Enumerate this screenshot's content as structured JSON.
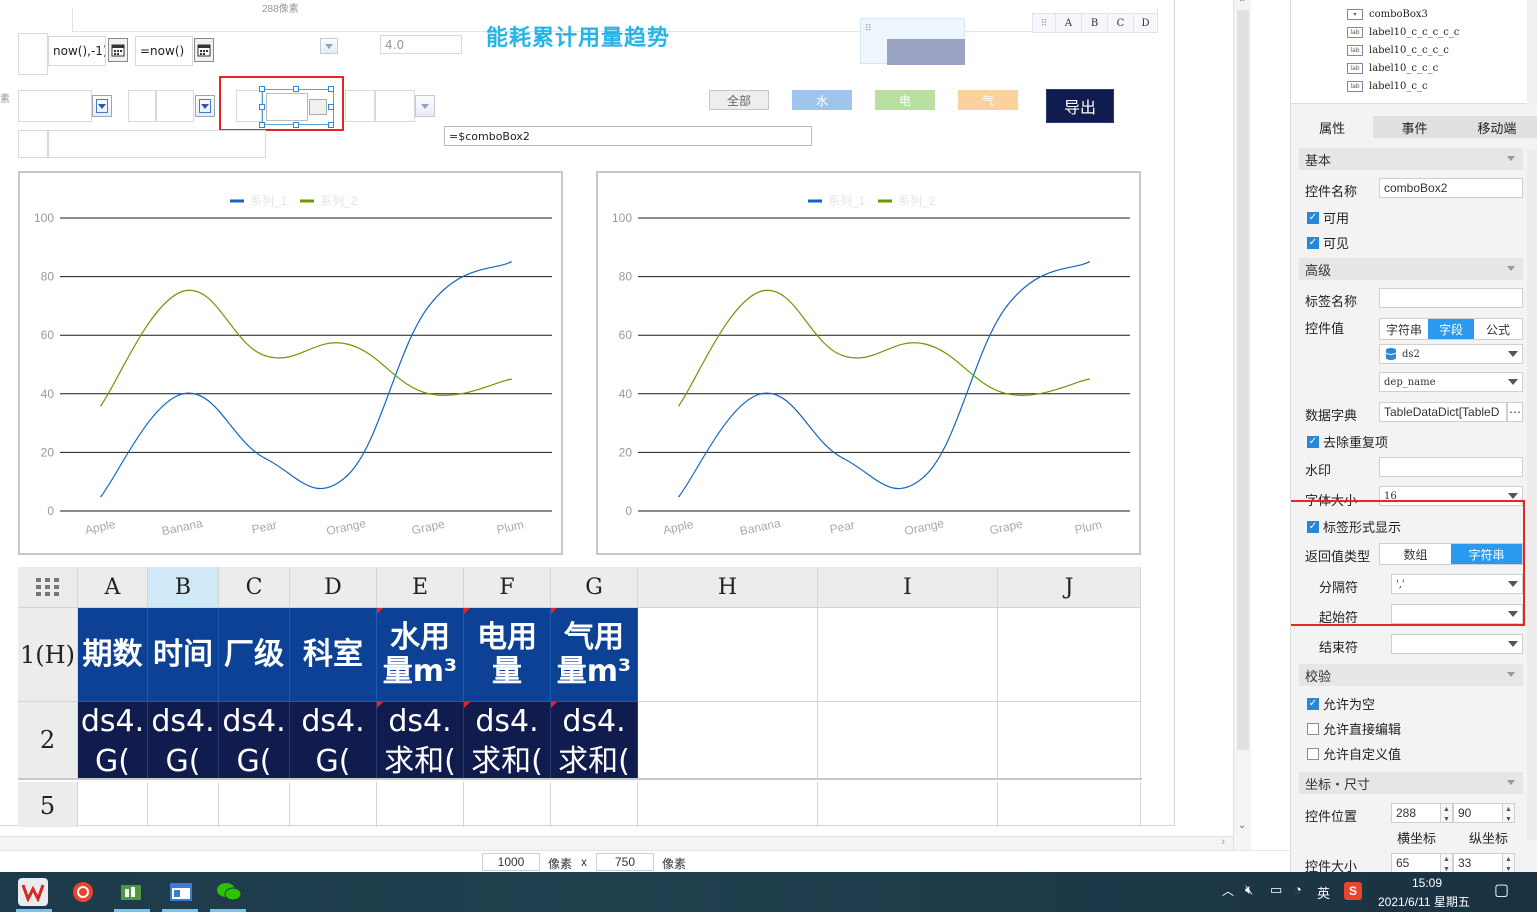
{
  "canvas": {
    "ruler_tip": "288像素",
    "ruler_side": "素",
    "title": "能耗累计用量趋势",
    "start_date_formula": "now(),-1)",
    "end_date_formula": "=now()",
    "version_field": "4.0",
    "combo_formula": "=$comboBox2",
    "filter_buttons": [
      {
        "label": "全部",
        "color": "#eeeeee",
        "text_color": "#666666"
      },
      {
        "label": "水",
        "color": "#9fc5ec",
        "text_color": "#ffffff"
      },
      {
        "label": "电",
        "color": "#b9dfa1",
        "text_color": "#ffffff"
      },
      {
        "label": "气",
        "color": "#fbd1a0",
        "text_color": "#ffffff"
      }
    ],
    "export_label": "导出",
    "mini_grid_cols": [
      "A",
      "B",
      "C",
      "D"
    ]
  },
  "chart_data": [
    {
      "type": "line",
      "categories": [
        "Apple",
        "Banana",
        "Pear",
        "Orange",
        "Grape",
        "Plum"
      ],
      "series": [
        {
          "name": "系列_1",
          "color": "#1565c0",
          "values": [
            5,
            40,
            18,
            12,
            70,
            85
          ]
        },
        {
          "name": "系列_2",
          "color": "#6a9a00",
          "values": [
            36,
            75,
            53,
            57,
            40,
            45
          ]
        }
      ],
      "yticks": [
        0,
        20,
        40,
        60,
        80,
        100
      ],
      "ylim": [
        0,
        100
      ],
      "smooth": true,
      "grid": true,
      "legend": "top-center"
    },
    {
      "type": "line",
      "categories": [
        "Apple",
        "Banana",
        "Pear",
        "Orange",
        "Grape",
        "Plum"
      ],
      "series": [
        {
          "name": "系列_1",
          "color": "#1565c0",
          "values": [
            5,
            40,
            18,
            12,
            70,
            85
          ]
        },
        {
          "name": "系列_2",
          "color": "#6a9a00",
          "values": [
            36,
            75,
            53,
            57,
            40,
            45
          ]
        }
      ],
      "yticks": [
        0,
        20,
        40,
        60,
        80,
        100
      ],
      "ylim": [
        0,
        100
      ],
      "smooth": true,
      "grid": true,
      "legend": "top-center"
    }
  ],
  "grid": {
    "columns": [
      "A",
      "B",
      "C",
      "D",
      "E",
      "F",
      "G",
      "H",
      "I",
      "J"
    ],
    "row_labels": [
      "1(H)",
      "2",
      "5"
    ],
    "header_cells": [
      "期数",
      "时间",
      "厂级",
      "科室",
      "水用量m³",
      "电用量",
      "气用量m³"
    ],
    "data_cells": [
      "ds4.G(",
      "ds4.G(",
      "ds4.G(",
      "ds4.G(",
      "ds4.求和(",
      "ds4.求和(",
      "ds4.求和("
    ]
  },
  "status": {
    "width": "1000",
    "height": "750",
    "unit": "像素",
    "times": "x"
  },
  "panel": {
    "tree_items": [
      "comboBox3",
      "label10_c_c_c_c_c",
      "label10_c_c_c_c",
      "label10_c_c_c",
      "label10_c_c"
    ],
    "tabs": [
      "属性",
      "事件",
      "移动端"
    ],
    "sections": {
      "basic": "基本",
      "advanced": "高级",
      "validate": "校验",
      "coords": "坐标・尺寸"
    },
    "control_name_label": "控件名称",
    "control_name": "comboBox2",
    "enabled_label": "可用",
    "visible_label": "可见",
    "tag_name_label": "标签名称",
    "control_value_label": "控件值",
    "value_modes": [
      "字符串",
      "字段",
      "公式"
    ],
    "dataset": "ds2",
    "field": "dep_name",
    "dict_label": "数据字典",
    "dict_value": "TableDataDict[TableD",
    "dedupe_label": "去除重复项",
    "watermark_label": "水印",
    "font_size_label": "字体大小",
    "font_size": "16",
    "tag_display_label": "标签形式显示",
    "return_type_label": "返回值类型",
    "return_types": [
      "数组",
      "字符串"
    ],
    "separator_label": "分隔符",
    "separator_value": "','",
    "start_label": "起始符",
    "end_label": "结束符",
    "allow_empty_label": "允许为空",
    "allow_edit_label": "允许直接编辑",
    "allow_custom_label": "允许自定义值",
    "position_label": "控件位置",
    "pos_x": "288",
    "pos_y": "90",
    "x_caption": "横坐标",
    "y_caption": "纵坐标",
    "size_label": "控件大小",
    "size_w": "65",
    "size_h": "33"
  },
  "taskbar": {
    "time": "15:09",
    "date": "2021/6/11 星期五",
    "ime": "英"
  }
}
